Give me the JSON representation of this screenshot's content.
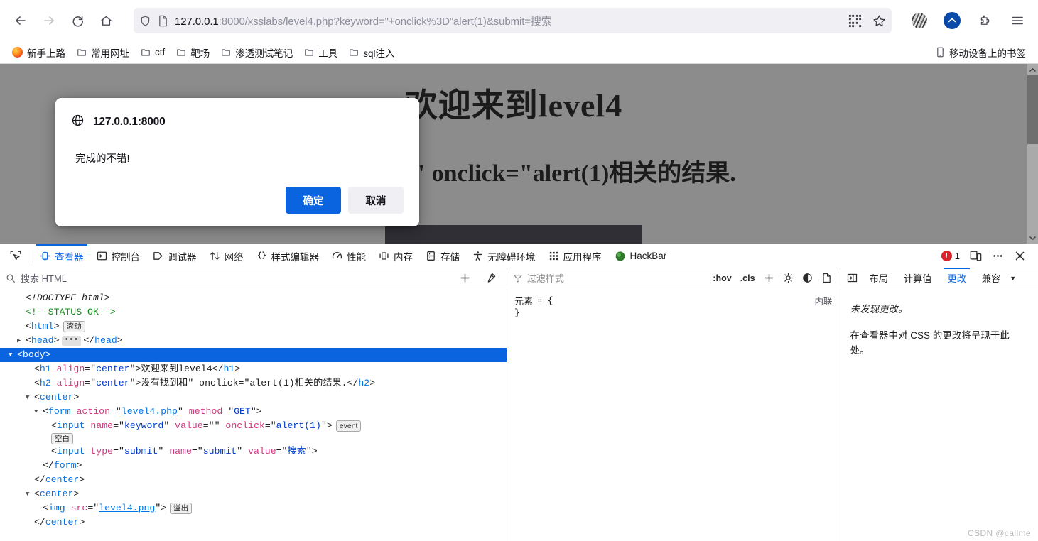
{
  "browser": {
    "nav": {
      "back_label": "Back",
      "forward_label": "Forward",
      "reload_label": "Reload",
      "home_label": "Home"
    },
    "urlbar": {
      "host": "127.0.0.1",
      "rest": ":8000/xsslabs/level4.php?keyword=\"+onclick%3D\"alert(1)&submit=搜索",
      "full_url": "127.0.0.1:8000/xsslabs/level4.php?keyword=\"+onclick%3D\"alert(1)&submit=搜索"
    },
    "bookmarks": [
      {
        "label": "新手上路",
        "icon": "firefox-icon"
      },
      {
        "label": "常用网址",
        "icon": "folder-icon"
      },
      {
        "label": "ctf",
        "icon": "folder-icon"
      },
      {
        "label": "靶场",
        "icon": "folder-icon"
      },
      {
        "label": "渗透测试笔记",
        "icon": "folder-icon"
      },
      {
        "label": "工具",
        "icon": "folder-icon"
      },
      {
        "label": "sql注入",
        "icon": "folder-icon"
      }
    ],
    "bookmarks_right": {
      "label": "移动设备上的书签",
      "icon": "mobile-icon"
    }
  },
  "page": {
    "heading": "欢迎来到level4",
    "subheading": "没有找到和\" onclick=\"alert(1)相关的结果."
  },
  "dialog": {
    "origin": "127.0.0.1:8000",
    "message": "完成的不错!",
    "confirm_label": "确定",
    "cancel_label": "取消",
    "primary_color": "#0a64e0"
  },
  "devtools": {
    "tabs": [
      {
        "label": "查看器",
        "icon": "inspector-icon",
        "active": true
      },
      {
        "label": "控制台",
        "icon": "console-icon",
        "active": false
      },
      {
        "label": "调试器",
        "icon": "debugger-icon",
        "active": false
      },
      {
        "label": "网络",
        "icon": "network-icon",
        "active": false
      },
      {
        "label": "样式编辑器",
        "icon": "style-editor-icon",
        "active": false
      },
      {
        "label": "性能",
        "icon": "performance-icon",
        "active": false
      },
      {
        "label": "内存",
        "icon": "memory-icon",
        "active": false
      },
      {
        "label": "存储",
        "icon": "storage-icon",
        "active": false
      },
      {
        "label": "无障碍环境",
        "icon": "accessibility-icon",
        "active": false
      },
      {
        "label": "应用程序",
        "icon": "application-icon",
        "active": false
      },
      {
        "label": "HackBar",
        "icon": "hackbar-icon",
        "active": false
      }
    ],
    "error_count": "1",
    "markup": {
      "search_placeholder": "搜索 HTML",
      "add_node_label": "+",
      "eyedropper_label": "取色器",
      "nodes": [
        {
          "indent": 0,
          "twisty": "none",
          "type": "doctype",
          "text": "<!DOCTYPE html>"
        },
        {
          "indent": 0,
          "twisty": "none",
          "type": "comment",
          "text": "<!--STATUS OK-->"
        },
        {
          "indent": 0,
          "twisty": "none",
          "type": "open",
          "tag": "html",
          "badge": "滚动"
        },
        {
          "indent": 0,
          "twisty": "collapsed",
          "type": "collapsed-pair",
          "tag": "head"
        },
        {
          "indent": 0,
          "twisty": "expanded",
          "type": "open",
          "tag": "body",
          "selected": true
        },
        {
          "indent": 1,
          "twisty": "none",
          "type": "text-el",
          "tag": "h1",
          "attrs": [
            {
              "name": "align",
              "value": "center"
            }
          ],
          "text": "欢迎来到level4"
        },
        {
          "indent": 1,
          "twisty": "none",
          "type": "text-el",
          "tag": "h2",
          "attrs": [
            {
              "name": "align",
              "value": "center"
            }
          ],
          "text": "没有找到和\" onclick=\"alert(1)相关的结果."
        },
        {
          "indent": 1,
          "twisty": "expanded",
          "type": "open",
          "tag": "center"
        },
        {
          "indent": 2,
          "twisty": "expanded",
          "type": "open",
          "tag": "form",
          "attrs": [
            {
              "name": "action",
              "value": "level4.php",
              "link": true
            },
            {
              "name": "method",
              "value": "GET"
            }
          ]
        },
        {
          "indent": 3,
          "twisty": "none",
          "type": "void",
          "tag": "input",
          "attrs": [
            {
              "name": "name",
              "value": "keyword"
            },
            {
              "name": "value",
              "value": ""
            },
            {
              "name": "onclick",
              "value": "alert(1)"
            }
          ],
          "badge": "event"
        },
        {
          "indent": 3,
          "twisty": "none",
          "type": "whitespace",
          "badge": "空白"
        },
        {
          "indent": 3,
          "twisty": "none",
          "type": "void",
          "tag": "input",
          "attrs": [
            {
              "name": "type",
              "value": "submit"
            },
            {
              "name": "name",
              "value": "submit"
            },
            {
              "name": "value",
              "value": "搜索"
            }
          ]
        },
        {
          "indent": 2,
          "twisty": "none",
          "type": "close",
          "tag": "form"
        },
        {
          "indent": 1,
          "twisty": "none",
          "type": "close",
          "tag": "center"
        },
        {
          "indent": 1,
          "twisty": "expanded",
          "type": "open",
          "tag": "center"
        },
        {
          "indent": 2,
          "twisty": "none",
          "type": "void",
          "tag": "img",
          "attrs": [
            {
              "name": "src",
              "value": "level4.png",
              "link": true
            }
          ],
          "badge": "溢出"
        },
        {
          "indent": 1,
          "twisty": "none",
          "type": "close",
          "tag": "center"
        }
      ]
    },
    "rules": {
      "filter_placeholder": "过滤样式",
      "hov_label": ":hov",
      "cls_label": ".cls",
      "add_rule_label": "+",
      "selector": "元素",
      "open_brace": "{",
      "close_brace": "}",
      "source": "内联"
    },
    "right_panel": {
      "tabs": [
        {
          "label": "布局",
          "active": false
        },
        {
          "label": "计算值",
          "active": false
        },
        {
          "label": "更改",
          "active": true
        },
        {
          "label": "兼容",
          "active": false
        }
      ],
      "changes_empty": "未发现更改。",
      "changes_hint": "在查看器中对 CSS 的更改将呈现于此处。"
    }
  },
  "watermark": "CSDN @cailme"
}
